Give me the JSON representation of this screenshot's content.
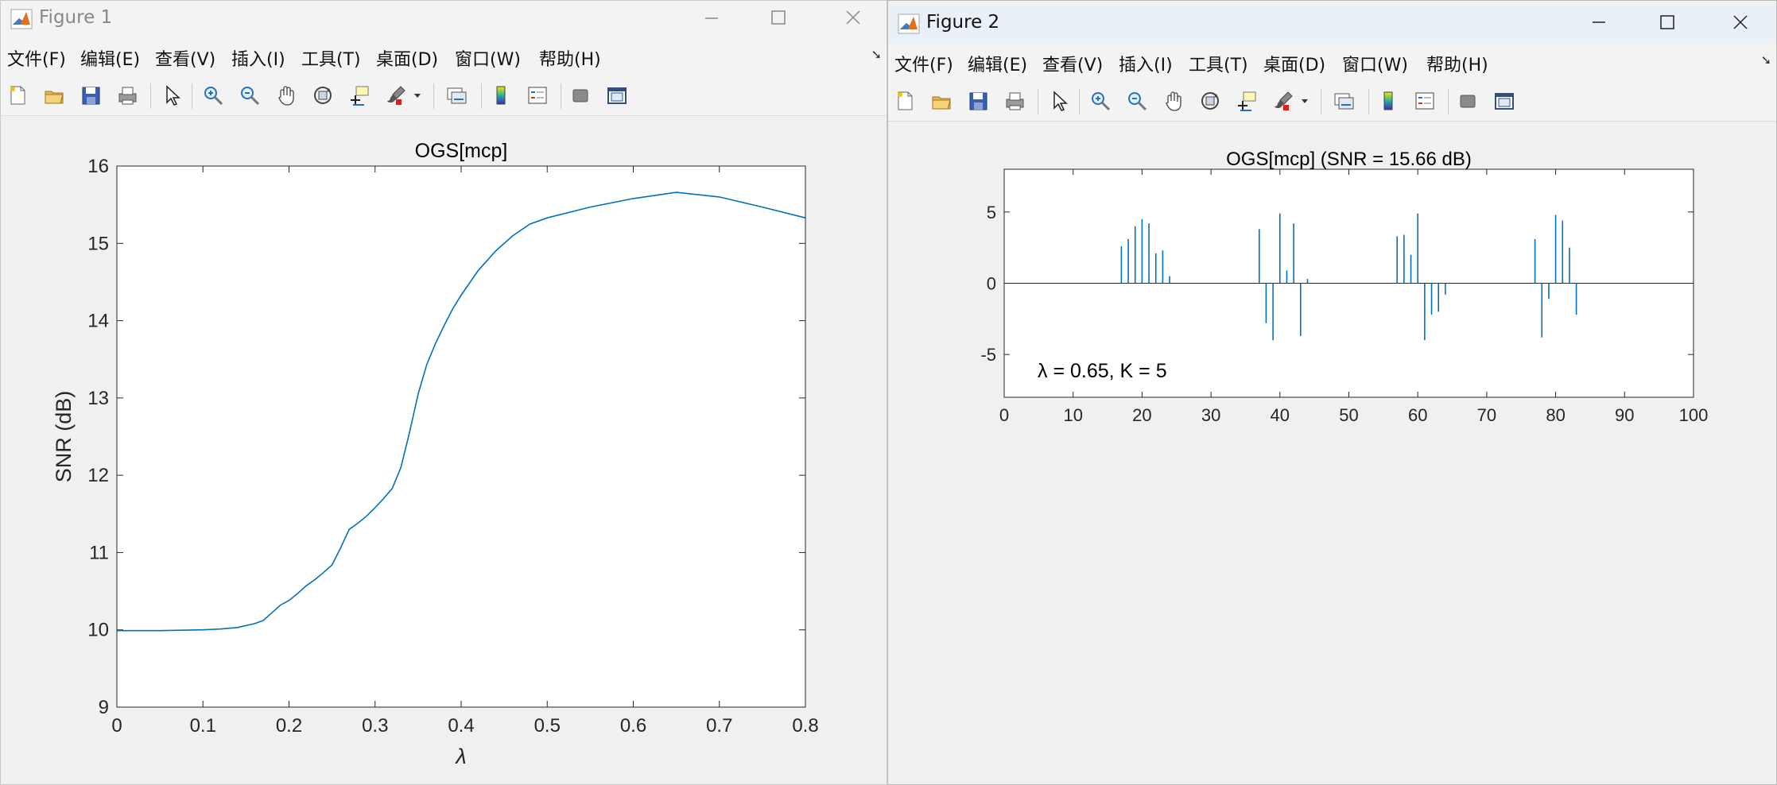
{
  "windows": [
    {
      "title": "Figure 1",
      "menu": [
        "文件(F)",
        "编辑(E)",
        "查看(V)",
        "插入(I)",
        "工具(T)",
        "桌面(D)",
        "窗口(W)",
        "帮助(H)"
      ],
      "axes_title": "OGS[mcp]",
      "xlabel": "λ",
      "ylabel": "SNR (dB)",
      "xticks": [
        "0",
        "0.1",
        "0.2",
        "0.3",
        "0.4",
        "0.5",
        "0.6",
        "0.7",
        "0.8"
      ],
      "yticks": [
        "9",
        "10",
        "11",
        "12",
        "13",
        "14",
        "15",
        "16"
      ]
    },
    {
      "title": "Figure 2",
      "menu": [
        "文件(F)",
        "编辑(E)",
        "查看(V)",
        "插入(I)",
        "工具(T)",
        "桌面(D)",
        "窗口(W)",
        "帮助(H)"
      ],
      "axes_title": "OGS[mcp] (SNR = 15.66 dB)",
      "annotation": "λ = 0.65, K = 5",
      "xticks": [
        "0",
        "10",
        "20",
        "30",
        "40",
        "50",
        "60",
        "70",
        "80",
        "90",
        "100"
      ],
      "yticks": [
        "5",
        "0",
        "-5"
      ]
    }
  ],
  "toolbar_icons": [
    "new-file",
    "open-folder",
    "save",
    "print",
    "select-pointer",
    "zoom-in",
    "zoom-out",
    "pan-hand",
    "rotate-3d",
    "data-cursor",
    "brush",
    "link-plot",
    "colorbar",
    "legend",
    "hide-plot-tools",
    "show-plot-tools"
  ],
  "colors": {
    "line": "#0072BD",
    "window_bg": "#f0f0f0",
    "axes_bg": "#ffffff"
  },
  "chart_data": [
    {
      "type": "line",
      "title": "OGS[mcp]",
      "xlabel": "λ",
      "ylabel": "SNR (dB)",
      "xlim": [
        0,
        0.8
      ],
      "ylim": [
        9,
        16
      ],
      "grid": false,
      "x": [
        0,
        0.05,
        0.1,
        0.12,
        0.14,
        0.16,
        0.17,
        0.18,
        0.19,
        0.2,
        0.21,
        0.22,
        0.23,
        0.24,
        0.25,
        0.26,
        0.27,
        0.28,
        0.29,
        0.3,
        0.31,
        0.32,
        0.33,
        0.34,
        0.35,
        0.36,
        0.37,
        0.38,
        0.39,
        0.4,
        0.42,
        0.44,
        0.46,
        0.48,
        0.5,
        0.55,
        0.6,
        0.65,
        0.7,
        0.75,
        0.8
      ],
      "y": [
        9.99,
        9.99,
        10.0,
        10.01,
        10.03,
        10.08,
        10.12,
        10.22,
        10.32,
        10.38,
        10.47,
        10.57,
        10.65,
        10.74,
        10.84,
        11.06,
        11.3,
        11.38,
        11.47,
        11.58,
        11.7,
        11.83,
        12.1,
        12.55,
        13.05,
        13.43,
        13.7,
        13.93,
        14.15,
        14.33,
        14.65,
        14.9,
        15.1,
        15.25,
        15.33,
        15.47,
        15.58,
        15.66,
        15.6,
        15.47,
        15.33
      ]
    },
    {
      "type": "stem",
      "title": "OGS[mcp] (SNR = 15.66 dB)",
      "xlim": [
        0,
        100
      ],
      "ylim": [
        -8,
        8
      ],
      "grid": false,
      "annotation": "λ = 0.65, K = 5",
      "x": [
        17,
        18,
        19,
        20,
        21,
        22,
        23,
        24,
        37,
        38,
        39,
        40,
        41,
        42,
        43,
        44,
        57,
        58,
        59,
        60,
        61,
        62,
        63,
        64,
        77,
        78,
        79,
        80,
        81,
        82,
        83
      ],
      "y": [
        2.6,
        3.1,
        4.0,
        4.5,
        4.2,
        2.1,
        2.3,
        0.5,
        3.8,
        -2.8,
        -4.0,
        4.9,
        0.9,
        4.2,
        -3.7,
        0.3,
        3.3,
        3.4,
        2.0,
        4.9,
        -4.0,
        -2.2,
        -2.0,
        -0.8,
        3.1,
        -3.8,
        -1.1,
        4.8,
        4.4,
        2.5,
        -2.2
      ]
    }
  ]
}
